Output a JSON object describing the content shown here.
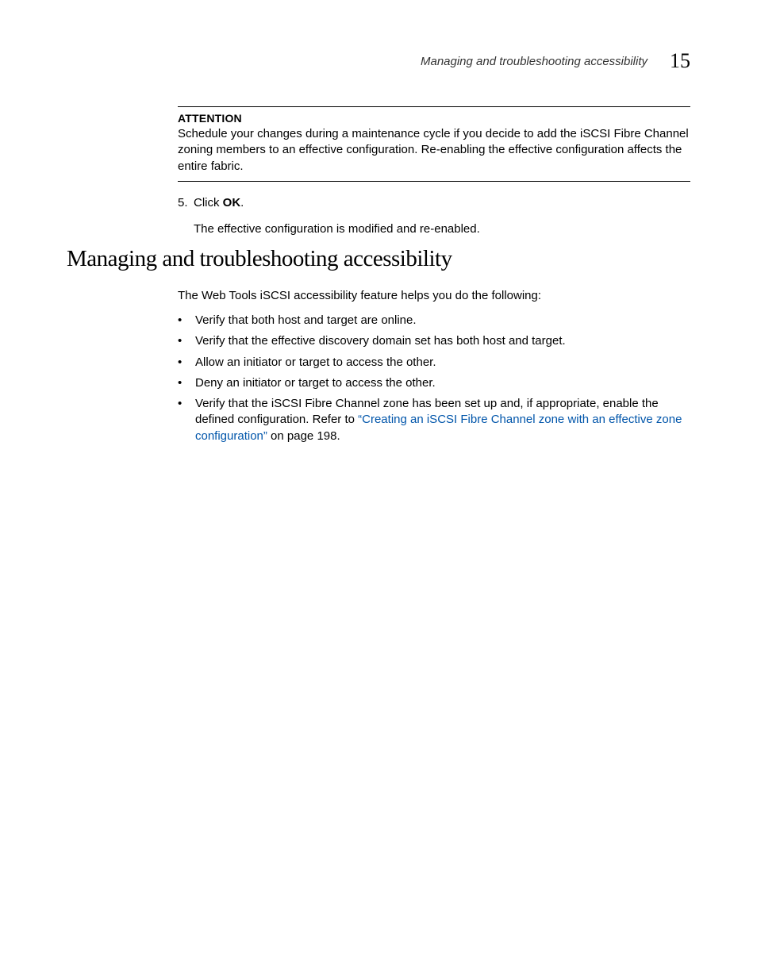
{
  "header": {
    "running_title": "Managing and troubleshooting accessibility",
    "chapter_number": "15"
  },
  "attention": {
    "label": "ATTENTION",
    "body": "Schedule your changes during a maintenance cycle if you decide to add the iSCSI Fibre Channel zoning members to an effective configuration. Re-enabling the effective configuration affects the entire fabric."
  },
  "step": {
    "number": "5.",
    "prefix": "Click ",
    "bold": "OK",
    "suffix": ".",
    "result": "The effective configuration is modified and re-enabled."
  },
  "section": {
    "heading": "Managing and troubleshooting accessibility",
    "intro": "The Web Tools iSCSI accessibility feature helps you do the following:"
  },
  "bullets": [
    "Verify that both host and target are online.",
    "Verify that the effective discovery domain set has both host and target.",
    "Allow an initiator or target to access the other.",
    "Deny an initiator or target to access the other."
  ],
  "bullet_last": {
    "prefix": "Verify that the iSCSI Fibre Channel zone has been set up and, if appropriate, enable the defined configuration. Refer to ",
    "link": "“Creating an iSCSI Fibre Channel zone with an effective zone configuration”",
    "suffix": " on page 198."
  }
}
